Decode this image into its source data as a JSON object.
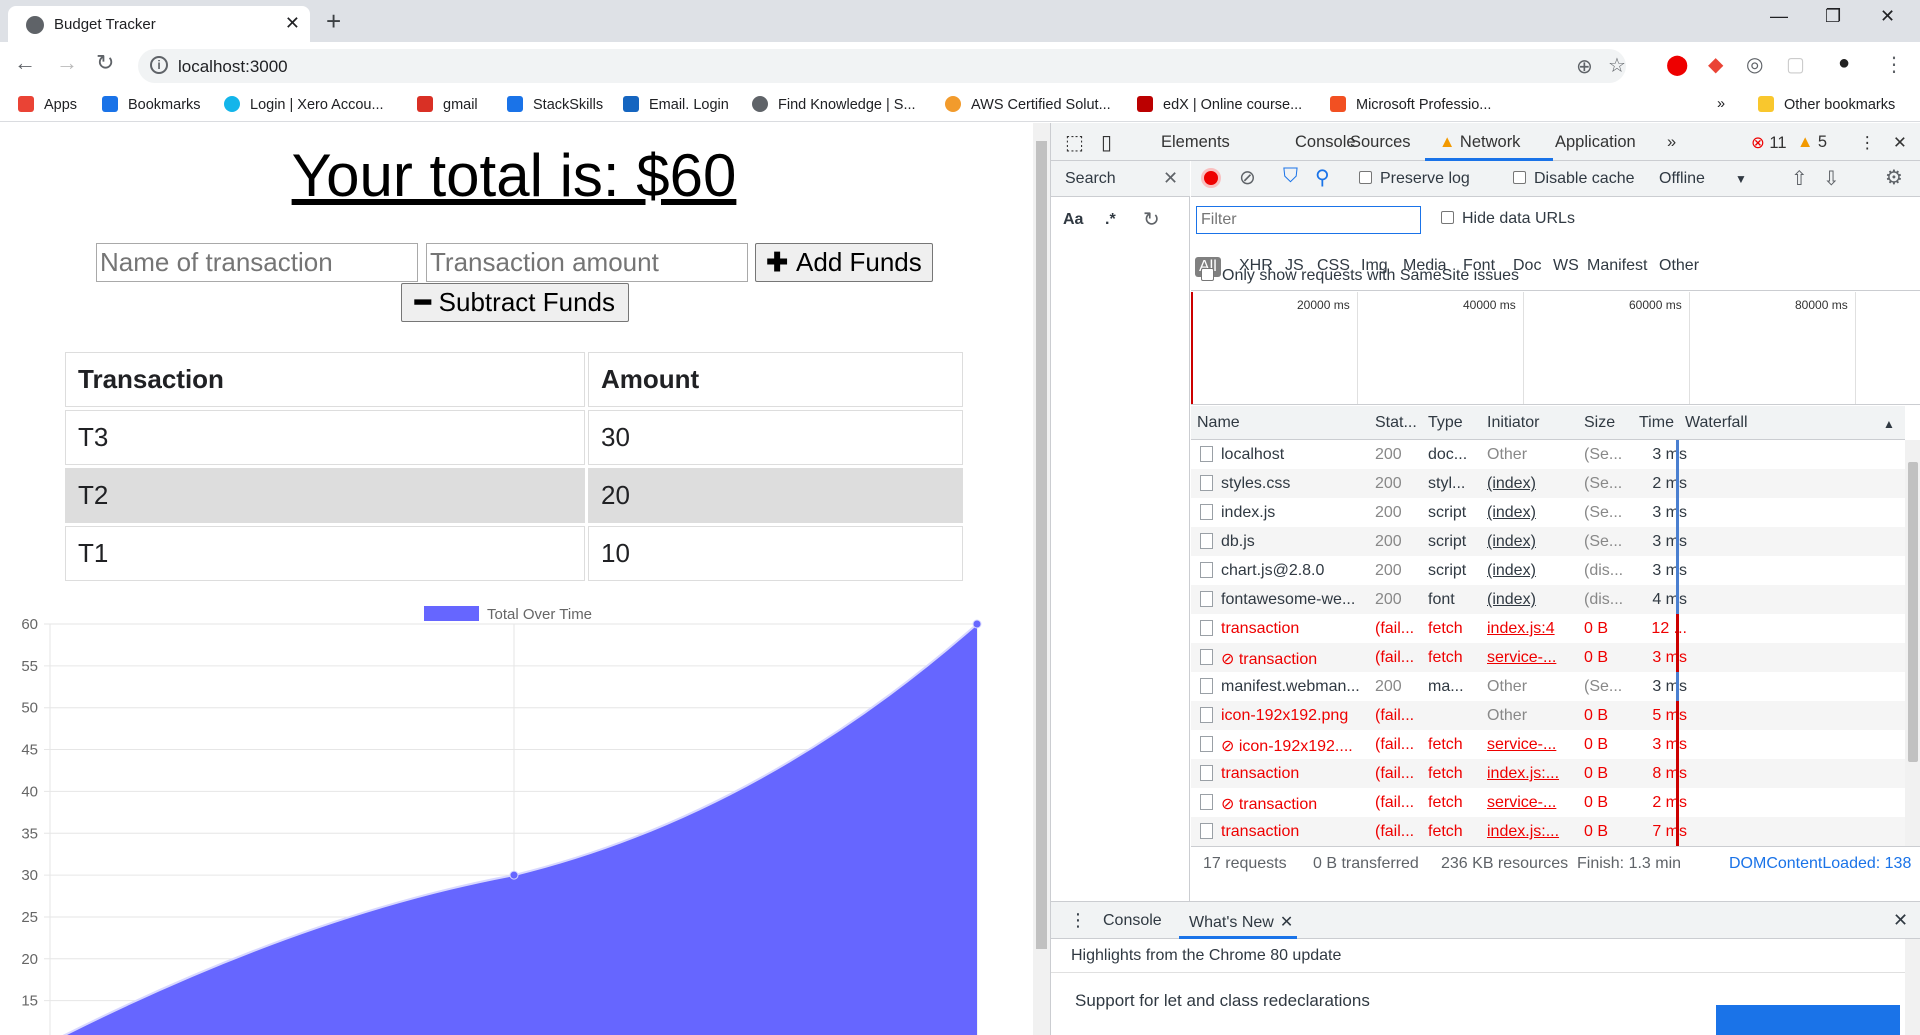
{
  "browser": {
    "tab_title": "Budget Tracker",
    "url": "localhost:3000",
    "bookmarks": [
      {
        "label": "Apps",
        "color": "#ea4335"
      },
      {
        "label": "Bookmarks",
        "color": "#1a73e8"
      },
      {
        "label": "Login | Xero Accou...",
        "color": "#13b5ea"
      },
      {
        "label": "gmail",
        "color": "#d93025"
      },
      {
        "label": "StackSkills",
        "color": "#1a73e8"
      },
      {
        "label": "Email. Login",
        "color": "#1565c0"
      },
      {
        "label": "Find Knowledge | S...",
        "color": "#5f6368"
      },
      {
        "label": "AWS Certified Solut...",
        "color": "#f29b2c"
      },
      {
        "label": "edX | Online course...",
        "color": "#b00"
      },
      {
        "label": "Microsoft Professio...",
        "color": "#f25022"
      }
    ],
    "other_bookmarks": "Other bookmarks",
    "more": "»"
  },
  "app": {
    "total_text": "Your total is: $60",
    "name_placeholder": "Name of transaction",
    "amount_placeholder": "Transaction amount",
    "add_label": "Add Funds",
    "subtract_label": "Subtract Funds",
    "table": {
      "headers": [
        "Transaction",
        "Amount"
      ],
      "rows": [
        [
          "T3",
          "30"
        ],
        [
          "T2",
          "20"
        ],
        [
          "T1",
          "10"
        ]
      ]
    }
  },
  "chart_data": {
    "type": "area",
    "legend": [
      "Total Over Time"
    ],
    "series": [
      {
        "name": "Total Over Time",
        "values": [
          10,
          30,
          60
        ],
        "color": "#6666ff"
      }
    ],
    "ylim": [
      15,
      60
    ],
    "yticks": [
      "60",
      "55",
      "50",
      "45",
      "40",
      "35",
      "30",
      "25",
      "20",
      "15"
    ],
    "grid": true,
    "legend_position": "top"
  },
  "devtools": {
    "tabs": [
      "Elements",
      "Console",
      "Sources",
      "Network",
      "Application",
      "»"
    ],
    "errors": "11",
    "warnings": "5",
    "search_label": "Search",
    "aa": "Aa",
    "regex": ".*",
    "preserve_log": "Preserve log",
    "disable_cache": "Disable cache",
    "throttle": "Offline",
    "filter_placeholder": "Filter",
    "hide_data_urls": "Hide data URLs",
    "types": [
      "All",
      "XHR",
      "JS",
      "CSS",
      "Img",
      "Media",
      "Font",
      "Doc",
      "WS",
      "Manifest",
      "Other"
    ],
    "samesite": "Only show requests with SameSite issues",
    "overview_ticks": [
      "20000 ms",
      "40000 ms",
      "60000 ms",
      "80000 ms"
    ],
    "columns": [
      "Name",
      "Stat...",
      "Type",
      "Initiator",
      "Size",
      "Time",
      "Waterfall"
    ],
    "requests": [
      {
        "name": "localhost",
        "status": "200",
        "type": "doc...",
        "initiator": "Other",
        "size": "(Se...",
        "time": "3 ms",
        "err": false,
        "plain": true
      },
      {
        "name": "styles.css",
        "status": "200",
        "type": "styl...",
        "initiator": "(index)",
        "size": "(Se...",
        "time": "2 ms",
        "err": false,
        "plain": false
      },
      {
        "name": "index.js",
        "status": "200",
        "type": "script",
        "initiator": "(index)",
        "size": "(Se...",
        "time": "3 ms",
        "err": false,
        "plain": false
      },
      {
        "name": "db.js",
        "status": "200",
        "type": "script",
        "initiator": "(index)",
        "size": "(Se...",
        "time": "3 ms",
        "err": false,
        "plain": false
      },
      {
        "name": "chart.js@2.8.0",
        "status": "200",
        "type": "script",
        "initiator": "(index)",
        "size": "(dis...",
        "time": "3 ms",
        "err": false,
        "plain": false
      },
      {
        "name": "fontawesome-we...",
        "status": "200",
        "type": "font",
        "initiator": "(index)",
        "size": "(dis...",
        "time": "4 ms",
        "err": false,
        "plain": false
      },
      {
        "name": "transaction",
        "status": "(fail...",
        "type": "fetch",
        "initiator": "index.js:4",
        "size": "0 B",
        "time": "12 ...",
        "err": true,
        "plain": false
      },
      {
        "name": "⊘ transaction",
        "status": "(fail...",
        "type": "fetch",
        "initiator": "service-...",
        "size": "0 B",
        "time": "3 ms",
        "err": true,
        "plain": false
      },
      {
        "name": "manifest.webman...",
        "status": "200",
        "type": "ma...",
        "initiator": "Other",
        "size": "(Se...",
        "time": "3 ms",
        "err": false,
        "plain": true
      },
      {
        "name": "icon-192x192.png",
        "status": "(fail...",
        "type": "",
        "initiator": "Other",
        "size": "0 B",
        "time": "5 ms",
        "err": true,
        "plain": true
      },
      {
        "name": "⊘ icon-192x192....",
        "status": "(fail...",
        "type": "fetch",
        "initiator": "service-...",
        "size": "0 B",
        "time": "3 ms",
        "err": true,
        "plain": false
      },
      {
        "name": "transaction",
        "status": "(fail...",
        "type": "fetch",
        "initiator": "index.js:...",
        "size": "0 B",
        "time": "8 ms",
        "err": true,
        "plain": false
      },
      {
        "name": "⊘ transaction",
        "status": "(fail...",
        "type": "fetch",
        "initiator": "service-...",
        "size": "0 B",
        "time": "2 ms",
        "err": true,
        "plain": false
      },
      {
        "name": "transaction",
        "status": "(fail...",
        "type": "fetch",
        "initiator": "index.js:...",
        "size": "0 B",
        "time": "7 ms",
        "err": true,
        "plain": false
      }
    ],
    "summary": {
      "requests": "17 requests",
      "transferred": "0 B transferred",
      "resources": "236 KB resources",
      "finish": "Finish: 1.3 min",
      "dcl": "DOMContentLoaded: 138"
    },
    "drawer_tabs": [
      "Console",
      "What's New"
    ],
    "drawer_heading": "Highlights from the Chrome 80 update",
    "drawer_item": "Support for let and class redeclarations"
  }
}
